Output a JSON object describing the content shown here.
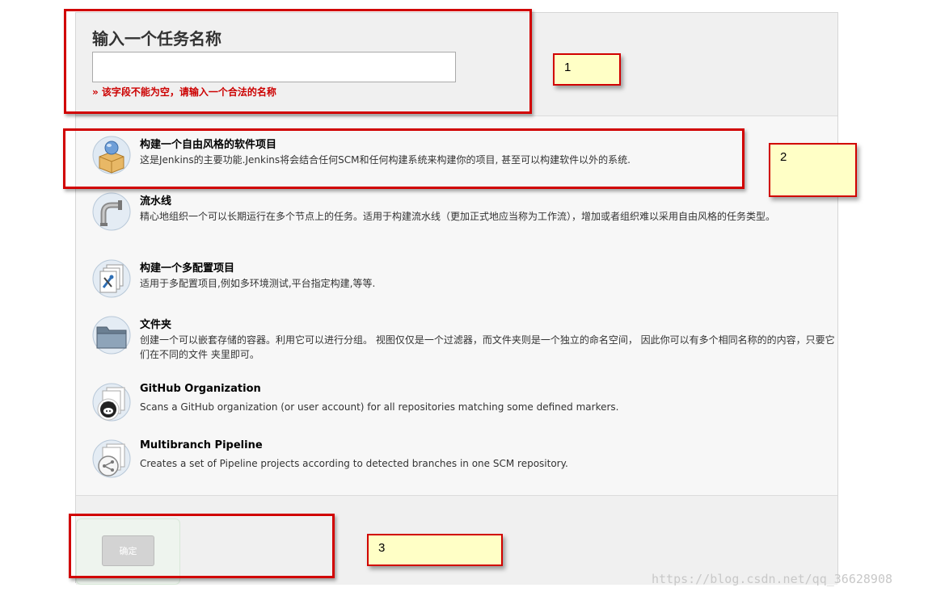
{
  "form": {
    "heading": "输入一个任务名称",
    "name_value": "",
    "error": "» 该字段不能为空，请输入一个合法的名称"
  },
  "job_types": [
    {
      "title": "构建一个自由风格的软件项目",
      "description": "这是Jenkins的主要功能.Jenkins将会结合任何SCM和任何构建系统来构建你的项目, 甚至可以构建软件以外的系统.",
      "icon": "freestyle-project-icon"
    },
    {
      "title": "流水线",
      "description": "精心地组织一个可以长期运行在多个节点上的任务。适用于构建流水线（更加正式地应当称为工作流），增加或者组织难以采用自由风格的任务类型。",
      "icon": "pipeline-icon"
    },
    {
      "title": "构建一个多配置项目",
      "description": "适用于多配置项目,例如多环境测试,平台指定构建,等等.",
      "icon": "multi-config-icon"
    },
    {
      "title": "文件夹",
      "description": "创建一个可以嵌套存储的容器。利用它可以进行分组。 视图仅仅是一个过滤器，而文件夹则是一个独立的命名空间， 因此你可以有多个相同名称的的内容，只要它们在不同的文件 夹里即可。",
      "icon": "folder-icon"
    },
    {
      "title": "GitHub Organization",
      "description": "Scans a GitHub organization (or user account) for all repositories matching some defined markers.",
      "icon": "github-organization-icon"
    },
    {
      "title": "Multibranch Pipeline",
      "description": "Creates a set of Pipeline projects according to detected branches in one SCM repository.",
      "icon": "multibranch-pipeline-icon"
    }
  ],
  "footer": {
    "ok_label": "确定"
  },
  "annotations": {
    "note1": "1",
    "note2": "2",
    "note3": "3"
  },
  "watermark": "https://blog.csdn.net/qq_36628908",
  "colors": {
    "annotation_border": "#d10000",
    "note_fill": "#ffffc6",
    "error_text": "#cc0000"
  }
}
